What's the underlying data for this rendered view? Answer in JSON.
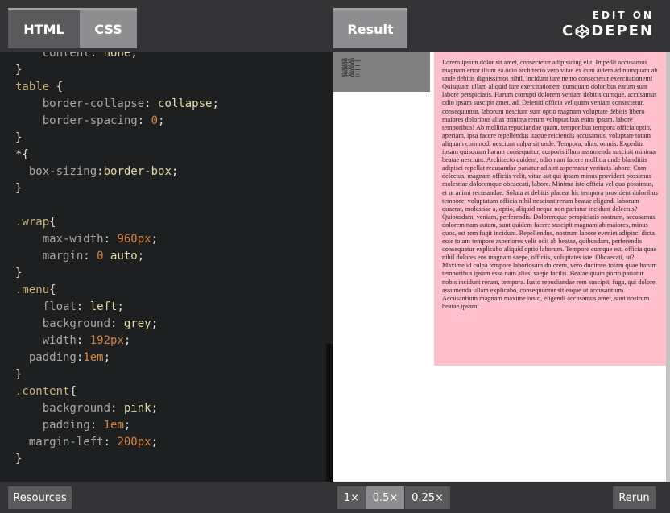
{
  "tabs": {
    "html": "HTML",
    "css": "CSS",
    "result": "Result"
  },
  "logo": {
    "line1": "EDIT ON",
    "pre": "C",
    "post": "DEPEN"
  },
  "code_lines": [
    [
      [
        "    ",
        "punc"
      ],
      [
        "content",
        "prop"
      ],
      [
        ": ",
        "punc"
      ],
      [
        "none",
        "val"
      ],
      [
        ";",
        "punc"
      ]
    ],
    [
      [
        "}",
        "punc"
      ]
    ],
    [
      [
        "table",
        "sel"
      ],
      [
        " {",
        "punc"
      ]
    ],
    [
      [
        "    ",
        "punc"
      ],
      [
        "border-collapse",
        "prop"
      ],
      [
        ": ",
        "punc"
      ],
      [
        "collapse",
        "val"
      ],
      [
        ";",
        "punc"
      ]
    ],
    [
      [
        "    ",
        "punc"
      ],
      [
        "border-spacing",
        "prop"
      ],
      [
        ": ",
        "punc"
      ],
      [
        "0",
        "num"
      ],
      [
        ";",
        "punc"
      ]
    ],
    [
      [
        "}",
        "punc"
      ]
    ],
    [
      [
        "*{",
        "punc"
      ]
    ],
    [
      [
        "  box-sizing",
        "prop"
      ],
      [
        ":",
        "punc"
      ],
      [
        "border-box",
        "val"
      ],
      [
        ";",
        "punc"
      ]
    ],
    [
      [
        "}",
        "punc"
      ]
    ],
    [
      [
        "",
        "punc"
      ]
    ],
    [
      [
        ".wrap",
        "sel"
      ],
      [
        "{",
        "punc"
      ]
    ],
    [
      [
        "    ",
        "punc"
      ],
      [
        "max-width",
        "prop"
      ],
      [
        ": ",
        "punc"
      ],
      [
        "960px",
        "num"
      ],
      [
        ";",
        "punc"
      ]
    ],
    [
      [
        "    ",
        "punc"
      ],
      [
        "margin",
        "prop"
      ],
      [
        ": ",
        "punc"
      ],
      [
        "0",
        "num"
      ],
      [
        " auto",
        "val"
      ],
      [
        ";",
        "punc"
      ]
    ],
    [
      [
        "}",
        "punc"
      ]
    ],
    [
      [
        ".menu",
        "sel"
      ],
      [
        "{",
        "punc"
      ]
    ],
    [
      [
        "    ",
        "punc"
      ],
      [
        "float",
        "prop"
      ],
      [
        ": ",
        "punc"
      ],
      [
        "left",
        "val"
      ],
      [
        ";",
        "punc"
      ]
    ],
    [
      [
        "    ",
        "punc"
      ],
      [
        "background",
        "prop"
      ],
      [
        ": ",
        "punc"
      ],
      [
        "grey",
        "val"
      ],
      [
        ";",
        "punc"
      ]
    ],
    [
      [
        "    ",
        "punc"
      ],
      [
        "width",
        "prop"
      ],
      [
        ": ",
        "punc"
      ],
      [
        "192px",
        "num"
      ],
      [
        ";",
        "punc"
      ]
    ],
    [
      [
        "  padding",
        "prop"
      ],
      [
        ":",
        "punc"
      ],
      [
        "1em",
        "num"
      ],
      [
        ";",
        "punc"
      ]
    ],
    [
      [
        "}",
        "punc"
      ]
    ],
    [
      [
        ".content",
        "sel"
      ],
      [
        "{",
        "punc"
      ]
    ],
    [
      [
        "    ",
        "punc"
      ],
      [
        "background",
        "prop"
      ],
      [
        ": ",
        "punc"
      ],
      [
        "pink",
        "val"
      ],
      [
        ";",
        "punc"
      ]
    ],
    [
      [
        "    ",
        "punc"
      ],
      [
        "padding",
        "prop"
      ],
      [
        ": ",
        "punc"
      ],
      [
        "1em",
        "num"
      ],
      [
        ";",
        "punc"
      ]
    ],
    [
      [
        "  margin-left",
        "prop"
      ],
      [
        ": ",
        "punc"
      ],
      [
        "200px",
        "num"
      ],
      [
        ";",
        "punc"
      ]
    ],
    [
      [
        "}",
        "punc"
      ]
    ]
  ],
  "result": {
    "menu_items": [
      "選項一",
      "選項二",
      "選項三"
    ],
    "content_text": "Lorem ipsum dolor sit amet, consectetur adipisicing elit. Impedit accusamus magnam error illum ea odio architecto vero vitae ex cum autem ad numquam ab unde debitis dignissimos nihil, incidunt iure nemo consectetur exercitationem! Quisquam ullam aliquid iure exercitationem numquam doloribus earum sunt labore perspiciatis. Harum corrupti dolorem veniam debitis cumque, accusamus odio ipsam suscipit amet, ad. Deleniti officia vel quam veniam consectetur, consequuntur, laborum nesciunt sunt optio magnam voluptate debitis libero maiores doloribus alias minima rerum voluptatibus enim ipsum, labore temporibus! Ab mollitia repudiandae quam, temporibus tempora officia optio, aperiam, ipsa facere repellendus itaque reiciendis accusamus, voluptate totam aliquam commodi nesciunt culpa sit unde. Tempora, alias, omnis. Expedita ipsam quisquam harum consequatur, corporis illum assumenda suscipit minima beatae nesciunt. Architecto quidem, odio nam facere mollitia unde blanditiis adipisci repellat recusandae pariatur ad sint aspernatur veritatis labore. Cum delectus, magnam officiis velit, vitae aut qui ipsam minus provident possimus molestiae doloremque obcaecati, labore. Minima iste officia vel quo possimus, et ut animi recusandae. Soluta at debitis placeat hic tempora provident doloribus tempore, voluptatum officia nihil nesciunt rerum beatae eligendi laborum quaerat, molestiae a, optio, aliquid neque non pariatur incidunt delectus? Quibusdam, veniam, perferendis. Doloremque perspiciatis nostrum, accusamus dolorem nam autem, sunt quidem facere suscipit magnam ab maiores, minus quos, est rem fugit incidunt. Repellendus, nostrum labore eveniet adipisci dicta esse totam tempore asperiores velit odit ab beatae, quibusdam, perferendis consequatur explicabo aliquid optio laborum. Tempore cumque est, officia quae nihil dolores eos magnam saepe, officiis, voluptates iste. Obcaecati, ut? Maxime id culpa tempore laboriosam dolorem, vero ducimus totam quae harum temporibus ipsam esse nam alias, saepe facilis. Beatae quam porro pariatur nobis incidunt rerum, tempora. Iusto repudiandae rem suscipit, fuga, qui dolore, assumenda ullam explicabo, consequuntur sit eaque ut accusantium. Accusantium magnam maxime iusto, eligendi accusamus amet, sunt nostrum beatae ipsam!"
  },
  "bottom": {
    "resources": "Resources",
    "rerun": "Rerun",
    "zoom": [
      "1×",
      "0.5×",
      "0.25×"
    ]
  },
  "colors": {
    "menu_bg": "#808080",
    "content_bg": "#ffc0cb"
  },
  "icons": {
    "logo": "codepen-cube-icon"
  }
}
